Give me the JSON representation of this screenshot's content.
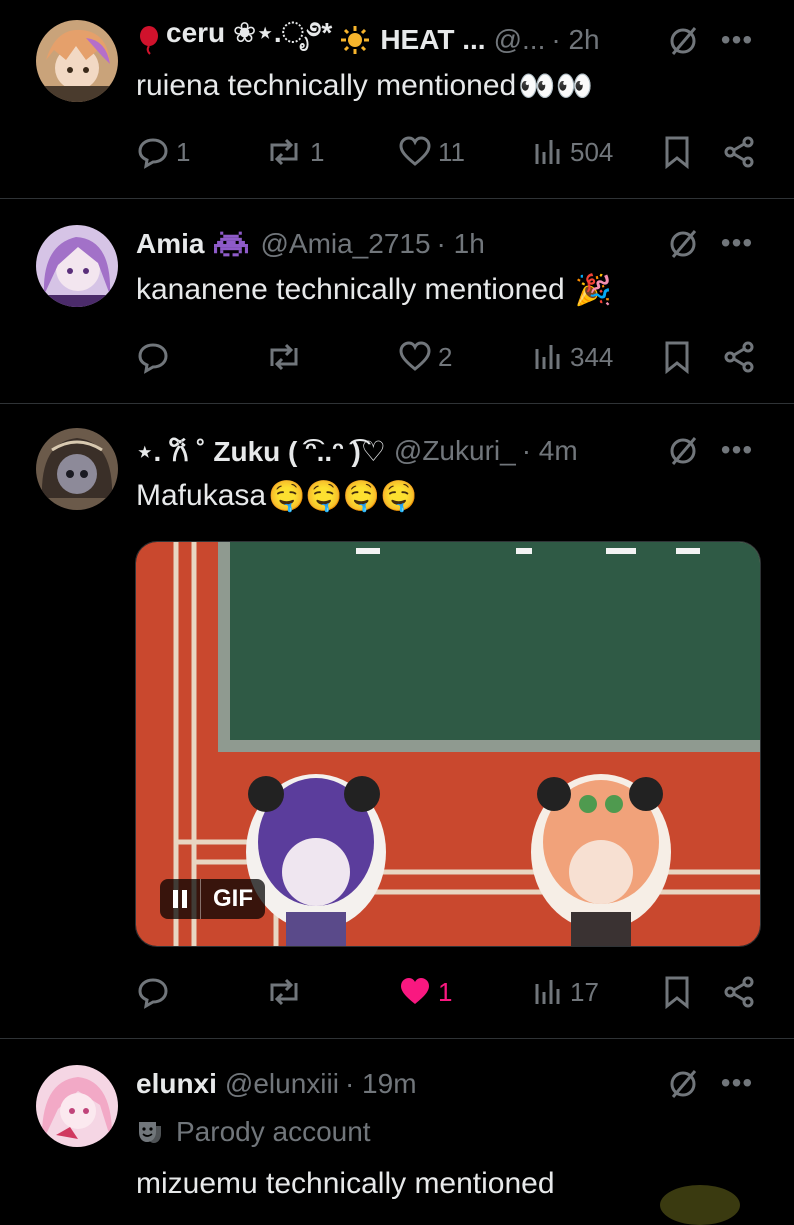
{
  "posts": [
    {
      "name": "ceru ❀⋆.ೃ࿔*",
      "name_suffix": "HEAT ...",
      "handle": "@...",
      "time": "· 2h",
      "text": "ruiena technically mentioned",
      "emoji": "👀👀",
      "replies": "1",
      "reposts": "1",
      "likes": "11",
      "views": "504"
    },
    {
      "name": "Amia",
      "handle": "@Amia_2715",
      "time": "· 1h",
      "text": "kananene technically mentioned",
      "emoji": "🎉",
      "replies": "",
      "reposts": "",
      "likes": "2",
      "views": "344"
    },
    {
      "name": "⋆. 𐙚 ˚ Zuku ( ͡ᵔ..ᵔ ͡)♡",
      "handle": "@Zukuri_",
      "time": "· 4m",
      "text": "Mafukasa",
      "emoji": "🤤🤤🤤🤤",
      "media": {
        "badge": "GIF"
      },
      "replies": "",
      "reposts": "",
      "likes": "1",
      "views": "17"
    },
    {
      "name": "elunxi",
      "handle": "@elunxiii",
      "time": "· 19m",
      "label": "Parody account",
      "text": "mizuemu technically mentioned"
    }
  ],
  "colors": {
    "background": "#000000",
    "text": "#e7e9ea",
    "muted": "#71767b",
    "divider": "#2f3336",
    "like_active": "#f91880"
  },
  "icons": [
    "reply-icon",
    "repost-icon",
    "like-icon",
    "views-icon",
    "bookmark-icon",
    "share-icon",
    "grok-icon",
    "more-icon",
    "pause-icon",
    "parody-mask-icon"
  ]
}
